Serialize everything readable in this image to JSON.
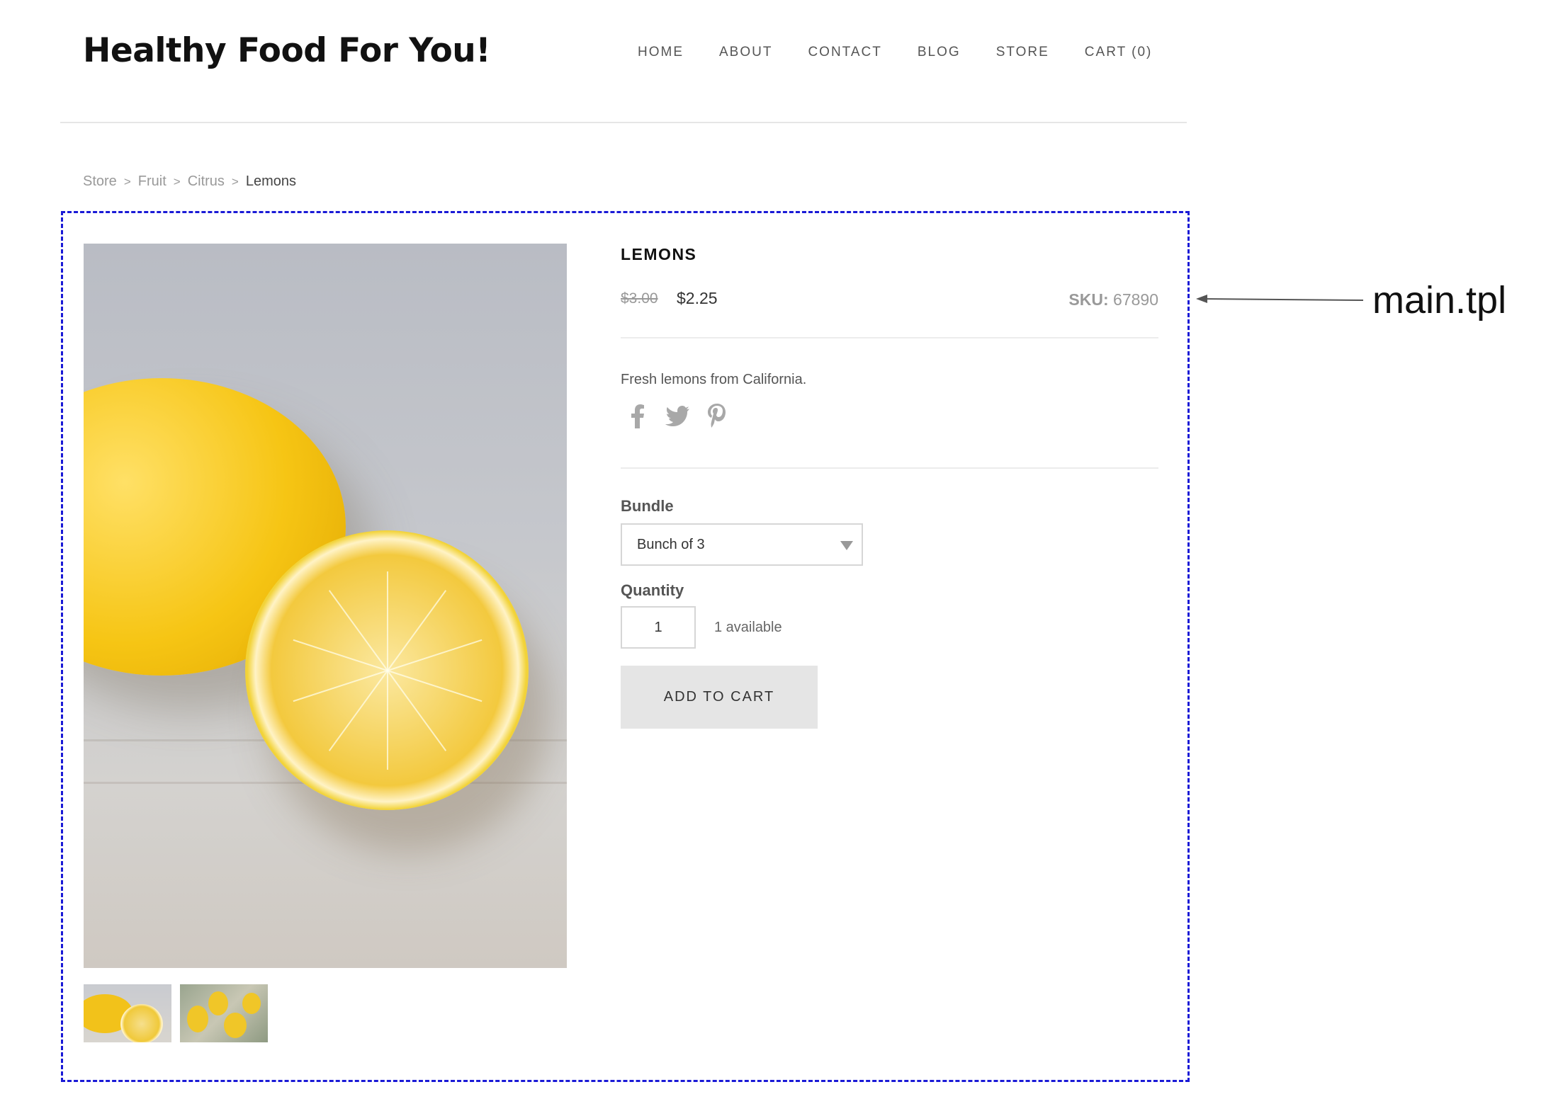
{
  "site": {
    "title": "Healthy Food For You!"
  },
  "nav": {
    "items": [
      {
        "label": "HOME"
      },
      {
        "label": "ABOUT"
      },
      {
        "label": "CONTACT"
      },
      {
        "label": "BLOG"
      },
      {
        "label": "STORE"
      },
      {
        "label": "CART (0)"
      }
    ]
  },
  "breadcrumb": {
    "separator": ">",
    "items": [
      "Store",
      "Fruit",
      "Citrus"
    ],
    "current": "Lemons"
  },
  "product": {
    "title": "LEMONS",
    "price_old": "$3.00",
    "price_new": "$2.25",
    "sku_label": "SKU:",
    "sku_value": "67890",
    "description": "Fresh lemons from California.",
    "social": [
      "facebook-icon",
      "twitter-icon",
      "pinterest-icon"
    ],
    "bundle_label": "Bundle",
    "bundle_selected": "Bunch of 3",
    "quantity_label": "Quantity",
    "quantity_value": "1",
    "available": "1 available",
    "add_to_cart": "ADD TO CART"
  },
  "annotation": {
    "label": "main.tpl",
    "frame_color": "#1a1ad6"
  }
}
